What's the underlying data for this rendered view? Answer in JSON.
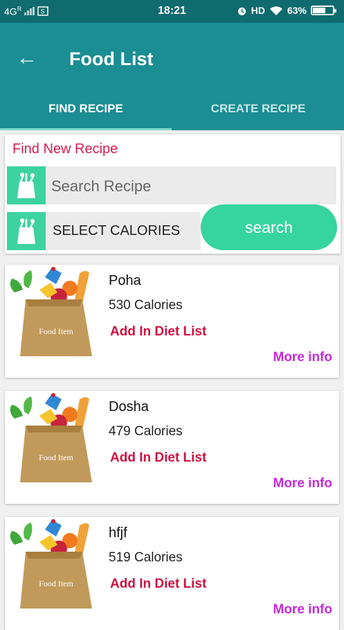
{
  "status_bar": {
    "network": "4G",
    "network_sup": "R",
    "time": "18:21",
    "hd": "HD",
    "battery": "63%",
    "battery_level": 0.63
  },
  "app_bar": {
    "title": "Food List"
  },
  "tabs": [
    {
      "label": "FIND RECIPE",
      "active": true
    },
    {
      "label": "CREATE RECIPE",
      "active": false
    }
  ],
  "find_card": {
    "heading": "Find New Recipe",
    "search_placeholder": "Search Recipe",
    "calories_label": "SELECT CALORIES",
    "search_button": "search"
  },
  "food_items": [
    {
      "name": "Poha",
      "calories": "530 Calories",
      "add_label": "Add In Diet List",
      "more_label": "More info",
      "image_label": "Food Item"
    },
    {
      "name": "Dosha",
      "calories": "479 Calories",
      "add_label": "Add In Diet List",
      "more_label": "More info",
      "image_label": "Food Item"
    },
    {
      "name": "hfjf",
      "calories": "519 Calories",
      "add_label": "Add In Diet List",
      "more_label": "More info",
      "image_label": "Food Item"
    }
  ],
  "colors": {
    "status_bar": "#106b6e",
    "app_bar": "#1a8e92",
    "accent_green": "#36d49e",
    "heading_red": "#d81b4f",
    "add_red": "#d0103f",
    "more_purple": "#c62adb"
  }
}
